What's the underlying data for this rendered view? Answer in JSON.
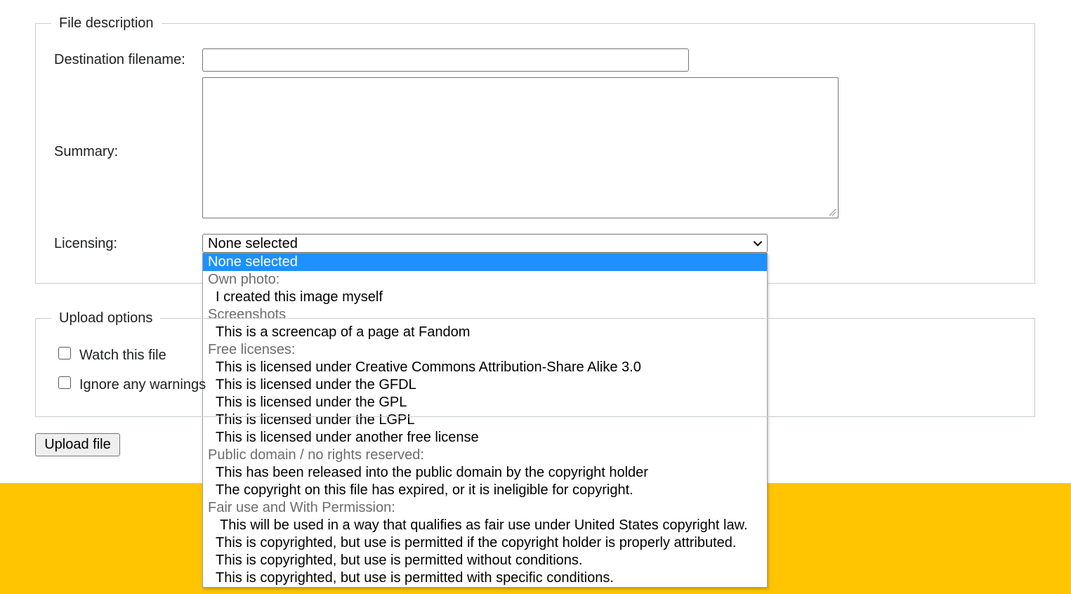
{
  "colors": {
    "footer_band": "#ffc500",
    "selected_option": "#1e90ff",
    "group_label_text": "#6d6d6d"
  },
  "file_description": {
    "legend": "File description",
    "destination_label": "Destination filename:",
    "destination_value": "",
    "summary_label": "Summary:",
    "summary_value": "",
    "licensing_label": "Licensing:",
    "licensing_selected": "None selected",
    "licensing_options": [
      {
        "type": "option",
        "label": "None selected",
        "selected": true
      },
      {
        "type": "group",
        "label": "Own photo:"
      },
      {
        "type": "option",
        "label": "I created this image myself"
      },
      {
        "type": "group",
        "label": "Screenshots"
      },
      {
        "type": "option",
        "label": "This is a screencap of a page at Fandom"
      },
      {
        "type": "group",
        "label": "Free licenses:"
      },
      {
        "type": "option",
        "label": "This is licensed under Creative Commons Attribution-Share Alike 3.0"
      },
      {
        "type": "option",
        "label": "This is licensed under the GFDL"
      },
      {
        "type": "option",
        "label": "This is licensed under the GPL"
      },
      {
        "type": "option",
        "label": "This is licensed under the LGPL"
      },
      {
        "type": "option",
        "label": "This is licensed under another free license"
      },
      {
        "type": "group",
        "label": "Public domain / no rights reserved:"
      },
      {
        "type": "option",
        "label": "This has been released into the public domain by the copyright holder"
      },
      {
        "type": "option",
        "label": "The copyright on this file has expired, or it is ineligible for copyright."
      },
      {
        "type": "group",
        "label": "Fair use and With Permission:"
      },
      {
        "type": "option",
        "label": "This will be used in a way that qualifies as fair use under United States copyright law."
      },
      {
        "type": "option",
        "label": "This is copyrighted, but use is permitted if the copyright holder is properly attributed."
      },
      {
        "type": "option",
        "label": "This is copyrighted, but use is permitted without conditions."
      },
      {
        "type": "option",
        "label": "This is copyrighted, but use is permitted with specific conditions."
      }
    ]
  },
  "upload_options": {
    "legend": "Upload options",
    "watch_label": "Watch this file",
    "watch_checked": false,
    "ignore_label": "Ignore any warnings",
    "ignore_checked": false
  },
  "upload_button_label": "Upload file"
}
